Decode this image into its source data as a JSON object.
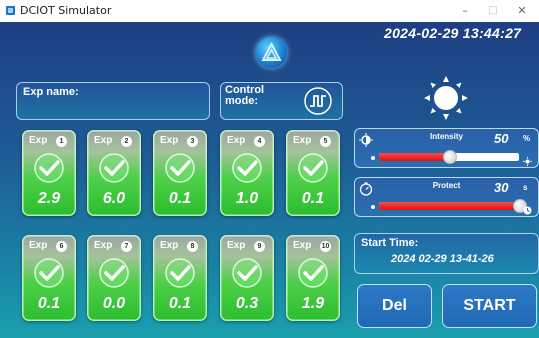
{
  "window": {
    "title": "DCIOT Simulator",
    "min_glyph": "–",
    "max_glyph": "□",
    "close_glyph": "✕"
  },
  "header": {
    "datetime": "2024-02-29 13:44:27"
  },
  "exp_name": {
    "label": "Exp name:",
    "value": ""
  },
  "control_mode": {
    "label_line1": "Control",
    "label_line2": "mode:",
    "icon": "square-wave-icon"
  },
  "experiments": [
    {
      "label": "Exp",
      "number": "1",
      "value": "2.9"
    },
    {
      "label": "Exp",
      "number": "2",
      "value": "6.0"
    },
    {
      "label": "Exp",
      "number": "3",
      "value": "0.1"
    },
    {
      "label": "Exp",
      "number": "4",
      "value": "1.0"
    },
    {
      "label": "Exp",
      "number": "5",
      "value": "0.1"
    },
    {
      "label": "Exp",
      "number": "6",
      "value": "0.1"
    },
    {
      "label": "Exp",
      "number": "7",
      "value": "0.0"
    },
    {
      "label": "Exp",
      "number": "8",
      "value": "0.1"
    },
    {
      "label": "Exp",
      "number": "9",
      "value": "0.3"
    },
    {
      "label": "Exp",
      "number": "10",
      "value": "1.9"
    }
  ],
  "intensity": {
    "label": "Intensity",
    "value": "50",
    "unit": "%",
    "fill_fraction": 0.5
  },
  "protect": {
    "label": "Protect",
    "value": "30",
    "unit": "s",
    "fill_fraction": 1.0
  },
  "start_time": {
    "label": "Start Time:",
    "value": "2024 02-29 13-41-26"
  },
  "buttons": {
    "del": "Del",
    "start": "START"
  },
  "colors": {
    "card_active": "#2bbd2d",
    "slider_fill": "#d61212",
    "accent": "#1f69b6"
  }
}
